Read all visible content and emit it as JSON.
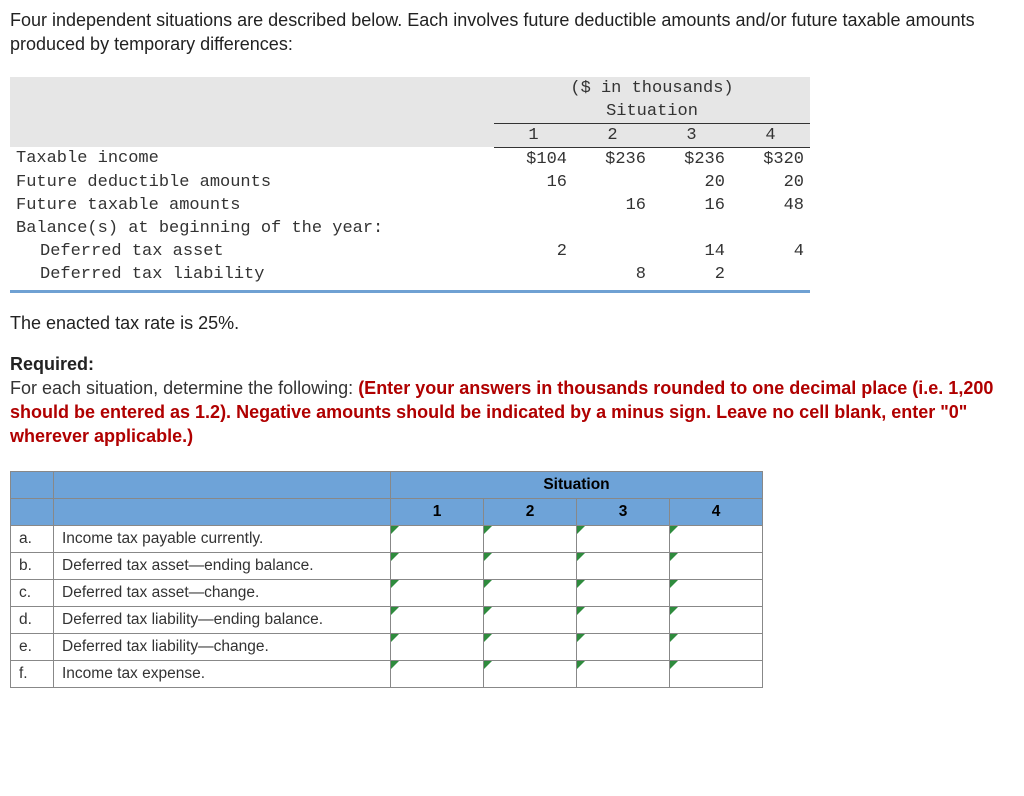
{
  "intro": "Four independent situations are described below. Each involves future deductible amounts and/or future taxable amounts produced by temporary differences:",
  "units_label": "($ in thousands)",
  "situation_label": "Situation",
  "situation_numbers": [
    "1",
    "2",
    "3",
    "4"
  ],
  "data_rows": [
    {
      "label": "Taxable income",
      "indent": false,
      "values": [
        "$104",
        "$236",
        "$236",
        "$320"
      ]
    },
    {
      "label": "Future deductible amounts",
      "indent": false,
      "values": [
        "16",
        "",
        "20",
        "20"
      ]
    },
    {
      "label": "Future taxable amounts",
      "indent": false,
      "values": [
        "",
        "16",
        "16",
        "48"
      ]
    },
    {
      "label": "Balance(s) at beginning of the year:",
      "indent": false,
      "values": [
        "",
        "",
        "",
        ""
      ]
    },
    {
      "label": "Deferred tax asset",
      "indent": true,
      "values": [
        "2",
        "",
        "14",
        "4"
      ]
    },
    {
      "label": "Deferred tax liability",
      "indent": true,
      "values": [
        "",
        "8",
        "2",
        ""
      ]
    }
  ],
  "tax_rate_line": "The enacted tax rate is 25%.",
  "required": {
    "heading": "Required:",
    "lead": "For each situation, determine the following: ",
    "bold": "(Enter your answers in thousands rounded to one decimal place (i.e. 1,200 should be entered as 1.2). Negative amounts should be indicated by a minus sign. Leave no cell blank, enter \"0\" wherever applicable.)"
  },
  "answer_grid": {
    "group_header": "Situation",
    "cols": [
      "1",
      "2",
      "3",
      "4"
    ],
    "rows": [
      {
        "letter": "a.",
        "desc": "Income tax payable currently."
      },
      {
        "letter": "b.",
        "desc": "Deferred tax asset—ending balance."
      },
      {
        "letter": "c.",
        "desc": "Deferred tax asset—change."
      },
      {
        "letter": "d.",
        "desc": "Deferred tax liability—ending balance."
      },
      {
        "letter": "e.",
        "desc": "Deferred tax liability—change."
      },
      {
        "letter": "f.",
        "desc": "Income tax expense."
      }
    ]
  }
}
